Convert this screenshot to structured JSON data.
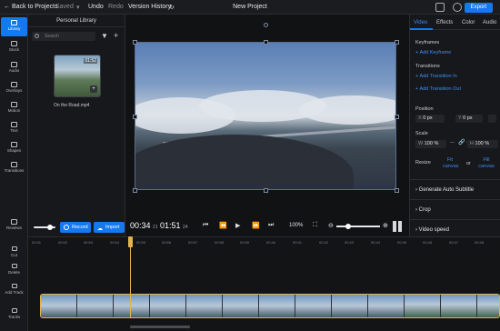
{
  "topbar": {
    "back_label": "Back to Projects",
    "saved_label": "Saved",
    "undo_label": "Undo",
    "redo_label": "Redo",
    "version_history_label": "Version History",
    "project_title": "New Project",
    "export_label": "Export"
  },
  "rail": {
    "items": [
      {
        "label": "Library",
        "icon": "library-icon",
        "active": true
      },
      {
        "label": "Stock",
        "icon": "stock-icon"
      },
      {
        "label": "Audio",
        "icon": "audio-icon"
      },
      {
        "label": "Overlays",
        "icon": "overlays-icon"
      },
      {
        "label": "Motion",
        "icon": "motion-icon"
      },
      {
        "label": "Text",
        "icon": "text-icon"
      },
      {
        "label": "Shapes",
        "icon": "shapes-icon"
      },
      {
        "label": "Transitions",
        "icon": "transitions-icon"
      }
    ],
    "reviews_label": "Reviews"
  },
  "library": {
    "title": "Personal Library",
    "search_placeholder": "Search",
    "clip": {
      "duration": "01:52",
      "name": "On the Road.mp4"
    },
    "record_label": "Record",
    "import_label": "Import"
  },
  "player": {
    "current_time": "00:34",
    "current_frames": "21",
    "total_time": "01:51",
    "total_frames": "24",
    "zoom": "100%"
  },
  "right_panel": {
    "tabs": [
      "Video",
      "Effects",
      "Color",
      "Audio"
    ],
    "keyframes_label": "Keyframes",
    "add_keyframe": "Add Keyframe",
    "transitions_label": "Transitions",
    "add_transition_in": "Add Transition In",
    "add_transition_out": "Add Transition Out",
    "position_label": "Position",
    "pos_x_label": "X",
    "pos_x": "0 px",
    "pos_y_label": "Y",
    "pos_y": "0 px",
    "scale_label": "Scale",
    "scale_w_label": "W",
    "scale_w": "100 %",
    "scale_h_label": "H",
    "scale_h": "100 %",
    "resize_label": "Resize",
    "fit_canvas": "Fit canvas",
    "or_label": "or",
    "fill_canvas": "Fill canvas",
    "auto_subtitle": "Generate Auto Subtitle",
    "crop": "Crop",
    "video_speed": "Video speed"
  },
  "timeline": {
    "ticks": [
      "00:51",
      "00:52",
      "00:53",
      "00:54",
      "00:55",
      "00:56",
      "00:57",
      "00:58",
      "00:59",
      "00:40",
      "00:41",
      "00:42",
      "00:43",
      "00:44",
      "00:45",
      "00:46",
      "00:47",
      "00:48"
    ],
    "tools": [
      {
        "label": "Cut",
        "icon": "cut-icon"
      },
      {
        "label": "Delete",
        "icon": "delete-icon"
      },
      {
        "label": "Add Track",
        "icon": "add-track-icon"
      },
      {
        "label": "Tracks",
        "icon": "tracks-icon"
      }
    ]
  },
  "colors": {
    "accent": "#1478f0",
    "playhead": "#e3b44c"
  }
}
